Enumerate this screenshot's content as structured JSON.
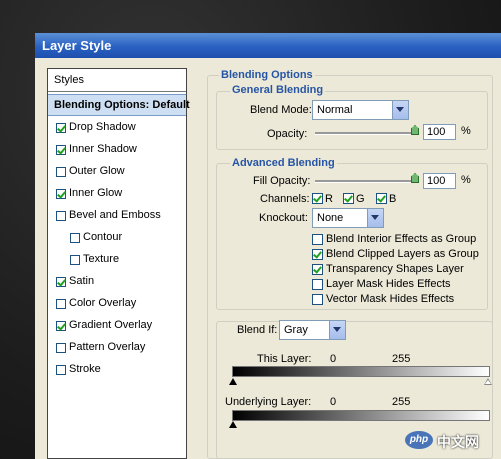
{
  "window": {
    "title": "Layer Style"
  },
  "sidebar": {
    "header": "Styles",
    "selected": "Blending Options: Default",
    "items": [
      {
        "label": "Drop Shadow",
        "checked": true
      },
      {
        "label": "Inner Shadow",
        "checked": true
      },
      {
        "label": "Outer Glow",
        "checked": false
      },
      {
        "label": "Inner Glow",
        "checked": true
      },
      {
        "label": "Bevel and Emboss",
        "checked": false
      },
      {
        "label": "Contour",
        "checked": false
      },
      {
        "label": "Texture",
        "checked": false
      },
      {
        "label": "Satin",
        "checked": true
      },
      {
        "label": "Color Overlay",
        "checked": false
      },
      {
        "label": "Gradient Overlay",
        "checked": true
      },
      {
        "label": "Pattern Overlay",
        "checked": false
      },
      {
        "label": "Stroke",
        "checked": false
      }
    ]
  },
  "blending": {
    "title": "Blending Options",
    "general": {
      "title": "General Blending",
      "blend_mode_label": "Blend Mode:",
      "blend_mode_value": "Normal",
      "opacity_label": "Opacity:",
      "opacity_value": "100",
      "unit": "%"
    },
    "advanced": {
      "title": "Advanced Blending",
      "fill_opacity_label": "Fill Opacity:",
      "fill_opacity_value": "100",
      "unit": "%",
      "channels_label": "Channels:",
      "channels": [
        {
          "label": "R",
          "checked": true
        },
        {
          "label": "G",
          "checked": true
        },
        {
          "label": "B",
          "checked": true
        }
      ],
      "knockout_label": "Knockout:",
      "knockout_value": "None",
      "options": [
        {
          "label": "Blend Interior Effects as Group",
          "checked": false
        },
        {
          "label": "Blend Clipped Layers as Group",
          "checked": true
        },
        {
          "label": "Transparency Shapes Layer",
          "checked": true
        },
        {
          "label": "Layer Mask Hides Effects",
          "checked": false
        },
        {
          "label": "Vector Mask Hides Effects",
          "checked": false
        }
      ]
    },
    "blend_if": {
      "label": "Blend If:",
      "value": "Gray",
      "this_layer_label": "This Layer:",
      "this_layer_min": "0",
      "this_layer_max": "255",
      "underlying_label": "Underlying Layer:",
      "underlying_min": "0",
      "underlying_max": "255"
    }
  },
  "watermark": {
    "logo": "php",
    "text": "中文网"
  }
}
